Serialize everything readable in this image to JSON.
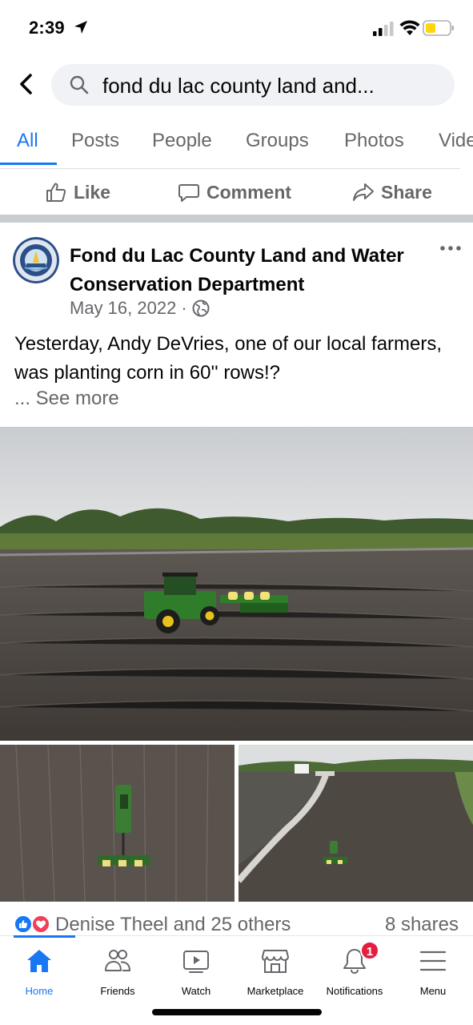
{
  "status_bar": {
    "time": "2:39",
    "icons": [
      "location-arrow-icon",
      "cellular-signal-icon",
      "wifi-icon",
      "battery-icon"
    ]
  },
  "search": {
    "query": "fond du lac county land and..."
  },
  "tabs": [
    {
      "label": "All",
      "active": true
    },
    {
      "label": "Posts"
    },
    {
      "label": "People"
    },
    {
      "label": "Groups"
    },
    {
      "label": "Photos"
    },
    {
      "label": "Vide"
    }
  ],
  "action_bar": {
    "like": "Like",
    "comment": "Comment",
    "share": "Share"
  },
  "post": {
    "page_name": "Fond du Lac County Land and Water Conservation Department",
    "date": "May 16, 2022",
    "separator": "·",
    "privacy_icon": "globe-icon",
    "text": "Yesterday, Andy DeVries, one of our local farmers, was planting corn in 60'' rows!?",
    "see_more": "... See more",
    "photos": [
      "tractor-field-photo",
      "tractor-aerial-photo",
      "field-road-aerial-photo"
    ]
  },
  "reactions": {
    "icons": [
      "like-reaction-icon",
      "love-reaction-icon"
    ],
    "text": "Denise Theel and 25 others",
    "shares": "8 shares"
  },
  "bottom_nav": [
    {
      "label": "Home",
      "icon": "home-icon",
      "active": true
    },
    {
      "label": "Friends",
      "icon": "friends-icon"
    },
    {
      "label": "Watch",
      "icon": "watch-icon"
    },
    {
      "label": "Marketplace",
      "icon": "marketplace-icon"
    },
    {
      "label": "Notifications",
      "icon": "bell-icon",
      "badge": "1"
    },
    {
      "label": "Menu",
      "icon": "menu-icon"
    }
  ],
  "colors": {
    "accent": "#1877f2",
    "secondary_text": "#65676b",
    "badge": "#e41e3f",
    "battery": "#ffd60a"
  }
}
